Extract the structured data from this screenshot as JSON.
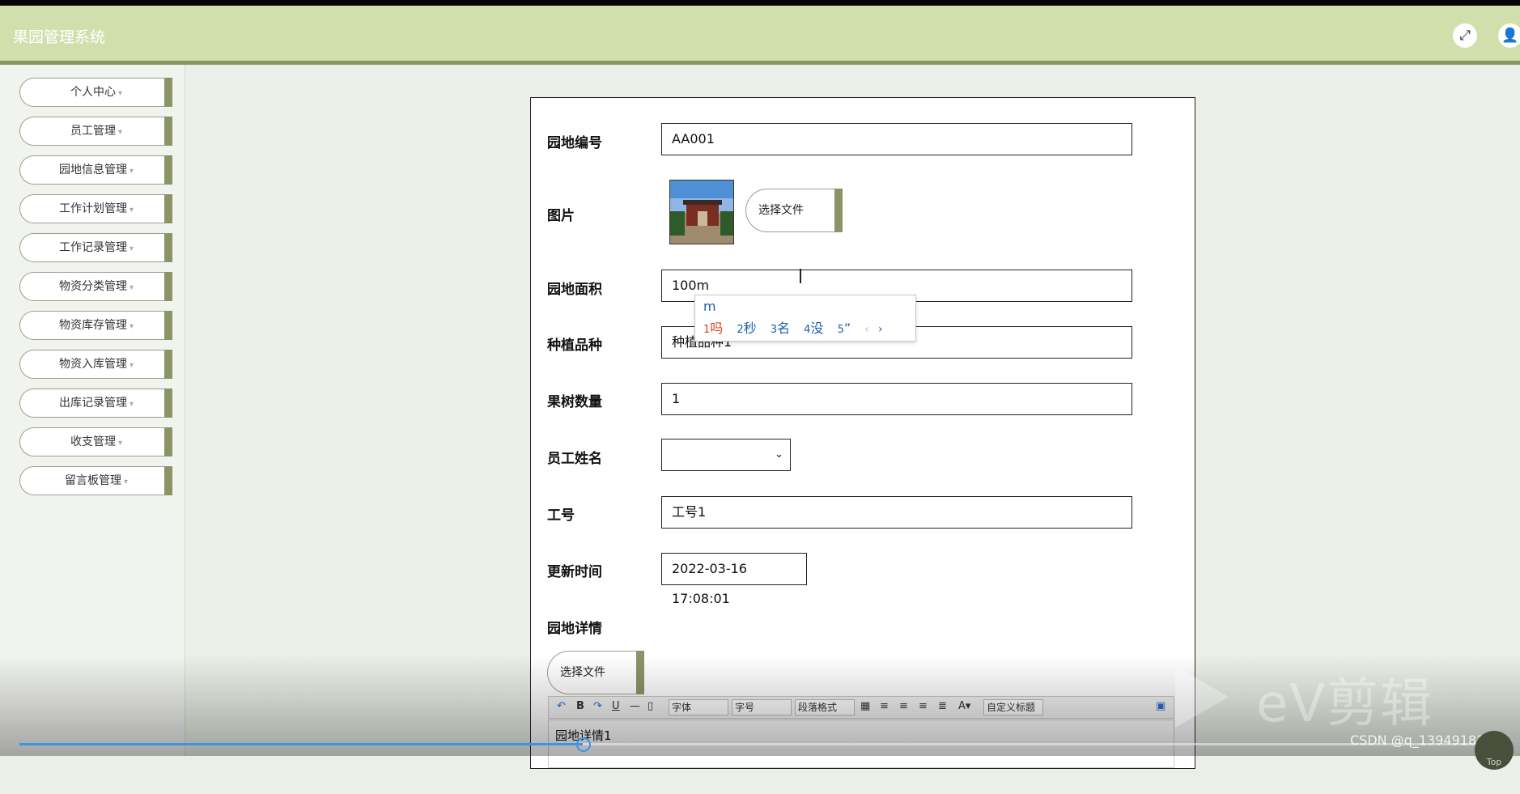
{
  "app": {
    "title": "果园管理系统"
  },
  "header": {
    "fullscreen_icon": "fullscreen-icon",
    "user_icon": "user-icon"
  },
  "sidebar": {
    "items": [
      {
        "label": "个人中心"
      },
      {
        "label": "员工管理"
      },
      {
        "label": "园地信息管理"
      },
      {
        "label": "工作计划管理"
      },
      {
        "label": "工作记录管理"
      },
      {
        "label": "物资分类管理"
      },
      {
        "label": "物资库存管理"
      },
      {
        "label": "物资入库管理"
      },
      {
        "label": "出库记录管理"
      },
      {
        "label": "收支管理"
      },
      {
        "label": "留言板管理"
      }
    ],
    "caret": "▾"
  },
  "form": {
    "garden_no": {
      "label": "园地编号",
      "value": "AA001"
    },
    "image": {
      "label": "图片",
      "button": "选择文件"
    },
    "area": {
      "label": "园地面积",
      "value": "100m"
    },
    "variety": {
      "label": "种植品种",
      "value": "种植品种1"
    },
    "tree_count": {
      "label": "果树数量",
      "value": "1"
    },
    "employee_name": {
      "label": "员工姓名",
      "value": ""
    },
    "employee_no": {
      "label": "工号",
      "value": "工号1"
    },
    "updated_at": {
      "label": "更新时间",
      "value": "2022-03-16 17:08:01"
    },
    "details": {
      "label": "园地详情",
      "button": "选择文件",
      "content": "园地详情1"
    }
  },
  "ime": {
    "composition": "m",
    "candidates": [
      {
        "n": "1",
        "text": "吗"
      },
      {
        "n": "2",
        "text": "秒"
      },
      {
        "n": "3",
        "text": "名"
      },
      {
        "n": "4",
        "text": "没"
      },
      {
        "n": "5",
        "text": "”"
      }
    ],
    "prev": "‹",
    "next": "›"
  },
  "editor_toolbar": {
    "font": "字体",
    "size": "字号",
    "paragraph": "段落格式",
    "heading": "自定义标题"
  },
  "video": {
    "watermark": "eV剪辑",
    "credit": "CSDN @q_1394918164",
    "top_label": "Top",
    "progress": 0.38
  }
}
